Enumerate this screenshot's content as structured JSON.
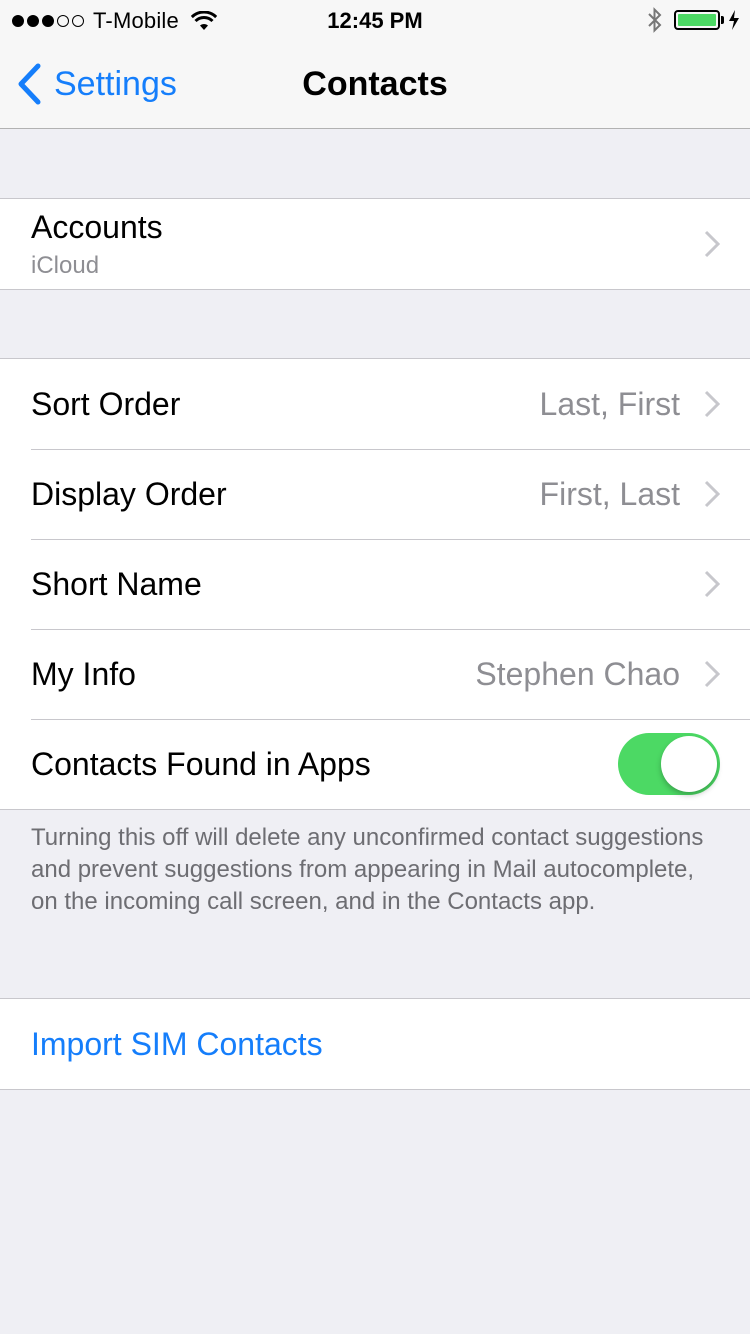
{
  "status_bar": {
    "carrier": "T-Mobile",
    "time": "12:45 PM",
    "signal_dots_filled": 3,
    "signal_dots_total": 5,
    "icons": [
      "wifi-icon",
      "bluetooth-icon",
      "battery-icon",
      "charging-bolt-icon"
    ],
    "battery_color": "#4cd964"
  },
  "nav": {
    "back_label": "Settings",
    "title": "Contacts",
    "accent": "#157efb"
  },
  "accounts": {
    "label": "Accounts",
    "sublabel": "iCloud"
  },
  "settings": {
    "sort_order": {
      "label": "Sort Order",
      "value": "Last, First"
    },
    "display_order": {
      "label": "Display Order",
      "value": "First, Last"
    },
    "short_name": {
      "label": "Short Name"
    },
    "my_info": {
      "label": "My Info",
      "value": "Stephen Chao"
    },
    "found_in_apps": {
      "label": "Contacts Found in Apps",
      "enabled": true
    }
  },
  "footer_note": "Turning this off will delete any unconfirmed contact suggestions and prevent suggestions from appearing in Mail autocomplete, on the incoming call screen, and in the Contacts app.",
  "import": {
    "label": "Import SIM Contacts"
  }
}
